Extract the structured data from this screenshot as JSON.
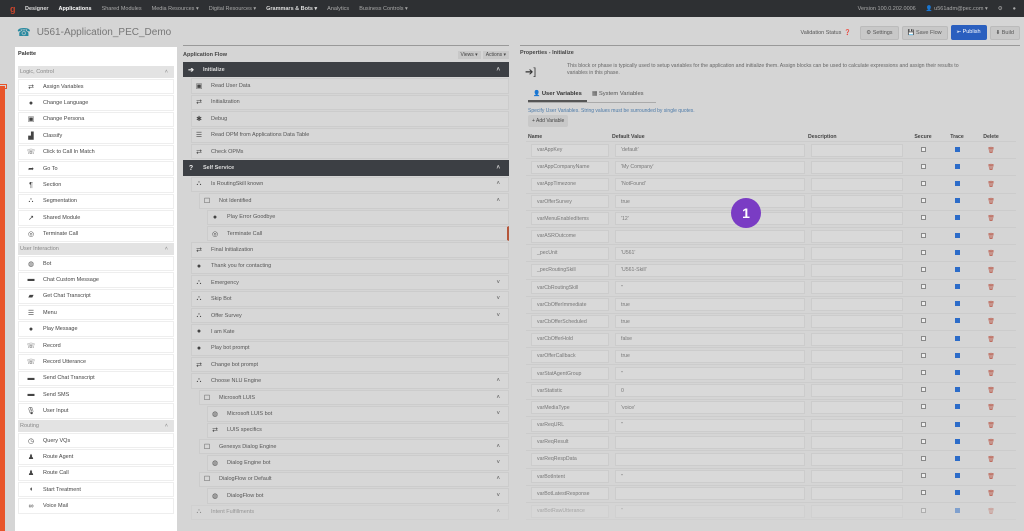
{
  "topbar": {
    "brand": "Designer",
    "nav": [
      {
        "label": "Applications",
        "active": true
      },
      {
        "label": "Shared Modules"
      },
      {
        "label": "Media Resources ▾"
      },
      {
        "label": "Digital Resources ▾"
      },
      {
        "label": "Grammars & Bots ▾",
        "bold": true
      },
      {
        "label": "Analytics"
      },
      {
        "label": "Business Controls ▾"
      }
    ],
    "version": "Version 100.0.202.0006",
    "user": "u561adm@pec.com ▾"
  },
  "app": {
    "title": "U561-Application_PEC_Demo"
  },
  "toolbar": {
    "validation": "Validation Status",
    "settings": "Settings",
    "save": "Save Flow",
    "publish": "Publish",
    "build": "Build"
  },
  "palette": {
    "title": "Palette",
    "sections": [
      {
        "title": "Logic, Control",
        "items": [
          [
            "⇄",
            "Assign Variables"
          ],
          [
            "●",
            "Change Language"
          ],
          [
            "▣",
            "Change Persona"
          ],
          [
            "▟",
            "Classify"
          ],
          [
            "☏",
            "Click to Call In Match"
          ],
          [
            "➦",
            "Go To"
          ],
          [
            "¶",
            "Section"
          ],
          [
            "⛬",
            "Segmentation"
          ],
          [
            "↗",
            "Shared Module"
          ],
          [
            "◎",
            "Terminate Call"
          ]
        ]
      },
      {
        "title": "User Interaction",
        "items": [
          [
            "◍",
            "Bot"
          ],
          [
            "▬",
            "Chat Custom Message"
          ],
          [
            "▰",
            "Get Chat Transcript"
          ],
          [
            "☰",
            "Menu"
          ],
          [
            "●",
            "Play Message"
          ],
          [
            "☏",
            "Record"
          ],
          [
            "☏",
            "Record Utterance"
          ],
          [
            "▬",
            "Send Chat Transcript"
          ],
          [
            "▬",
            "Send SMS"
          ],
          [
            "🎙",
            "User Input"
          ]
        ]
      },
      {
        "title": "Routing",
        "items": [
          [
            "◷",
            "Query VQs"
          ],
          [
            "♟",
            "Route Agent"
          ],
          [
            "♟",
            "Route Call"
          ],
          [
            "◖",
            "Start Treatment"
          ],
          [
            "∞",
            "Voice Mail"
          ]
        ]
      }
    ]
  },
  "flow": {
    "title": "Application Flow",
    "views": "Views ▾",
    "actions": "Actions ▾",
    "rows": [
      {
        "lvl": 0,
        "phase": true,
        "icon": "➔",
        "label": "Initialize",
        "chev": "˄"
      },
      {
        "lvl": 1,
        "icon": "▣",
        "label": "Read User Data"
      },
      {
        "lvl": 1,
        "icon": "⇄",
        "label": "Initialization"
      },
      {
        "lvl": 1,
        "icon": "✱",
        "label": "Debug"
      },
      {
        "lvl": 1,
        "icon": "☰",
        "label": "Read OPM from Applications Data Table"
      },
      {
        "lvl": 1,
        "icon": "⇄",
        "label": "Check OPMs"
      },
      {
        "lvl": 0,
        "phase": true,
        "icon": "?",
        "label": "Self Service",
        "chev": "˄"
      },
      {
        "lvl": 1,
        "icon": "⛬",
        "label": "Is RoutingSkill known",
        "chev": "˄"
      },
      {
        "lvl": 2,
        "icon": "☐",
        "label": "Not Identified",
        "chev": "˄"
      },
      {
        "lvl": 3,
        "icon": "●",
        "label": "Play Error Goodbye"
      },
      {
        "lvl": 3,
        "icon": "◎",
        "label": "Terminate Call",
        "sel": true
      },
      {
        "lvl": 1,
        "icon": "⇄",
        "label": "Final Initialization"
      },
      {
        "lvl": 1,
        "icon": "●",
        "label": "Thank you for contacting"
      },
      {
        "lvl": 1,
        "icon": "⛬",
        "label": "Emergency",
        "chev": "˅"
      },
      {
        "lvl": 1,
        "icon": "⛬",
        "label": "Skip Bot",
        "chev": "˅"
      },
      {
        "lvl": 1,
        "icon": "⛬",
        "label": "Offer Survey",
        "chev": "˅"
      },
      {
        "lvl": 1,
        "icon": "●",
        "label": "I am Kate"
      },
      {
        "lvl": 1,
        "icon": "●",
        "label": "Play bot prompt"
      },
      {
        "lvl": 1,
        "icon": "⇄",
        "label": "Change bot prompt"
      },
      {
        "lvl": 1,
        "icon": "⛬",
        "label": "Choose NLU Engine",
        "chev": "˄"
      },
      {
        "lvl": 2,
        "icon": "☐",
        "label": "Microsoft LUIS",
        "chev": "˄"
      },
      {
        "lvl": 3,
        "icon": "◍",
        "label": "Microsoft LUIS bot",
        "chev": "˅"
      },
      {
        "lvl": 3,
        "icon": "⇄",
        "label": "LUIS specifics"
      },
      {
        "lvl": 2,
        "icon": "☐",
        "label": "Genesys Dialog Engine",
        "chev": "˄"
      },
      {
        "lvl": 3,
        "icon": "◍",
        "label": "Dialog Engine bot",
        "chev": "˅"
      },
      {
        "lvl": 2,
        "icon": "☐",
        "label": "DialogFlow or Default",
        "chev": "˄"
      },
      {
        "lvl": 3,
        "icon": "◍",
        "label": "DialogFlow bot",
        "chev": "˅"
      },
      {
        "lvl": 1,
        "icon": "⛬",
        "label": "Intent Fulfillments",
        "chev": "˄"
      }
    ]
  },
  "props": {
    "title": "Properties - Initialize",
    "description": "This block or phase is typically used to setup variables for the application and initialize them. Assign blocks can be used to calculate expressions and assign their results to variables in this phase.",
    "tab_user": "User Variables",
    "tab_system": "System Variables",
    "hint": "Specify User Variables. String values must be surrounded by single quotes.",
    "add": "+ Add Variable",
    "columns": [
      "Name",
      "Default Value",
      "Description",
      "Secure",
      "Trace",
      "Delete"
    ],
    "rows": [
      [
        "varAppKey",
        "'default'"
      ],
      [
        "varAppCompanyName",
        "'My Company'"
      ],
      [
        "varAppTimezone",
        "'NotFound'"
      ],
      [
        "varOfferSurvey",
        "true"
      ],
      [
        "varMenuEnabledItems",
        "'12'"
      ],
      [
        "varASROutcome",
        ""
      ],
      [
        "_pecUnit",
        "'U561'"
      ],
      [
        "_pecRoutingSkill",
        "'U561-Skill'"
      ],
      [
        "varCbRoutingSkill",
        "''"
      ],
      [
        "varCbOfferImmediate",
        "true"
      ],
      [
        "varCbOfferScheduled",
        "true"
      ],
      [
        "varCbOfferHold",
        "false"
      ],
      [
        "varOfferCallback",
        "true"
      ],
      [
        "varStatAgentGroup",
        "''"
      ],
      [
        "varStatistic",
        "0"
      ],
      [
        "varMediaType",
        "'voice'"
      ],
      [
        "varReqURL",
        "''"
      ],
      [
        "varReqResult",
        ""
      ],
      [
        "varReqRespData",
        ""
      ],
      [
        "varBotIntent",
        "''"
      ],
      [
        "varBotLatestResponse",
        ""
      ],
      [
        "varBotRawUtterance",
        "''"
      ]
    ]
  },
  "badge": "1",
  "colors": {
    "accent": "#e8552a",
    "publish": "#2a5fbf",
    "badge": "#7a3cc4"
  }
}
